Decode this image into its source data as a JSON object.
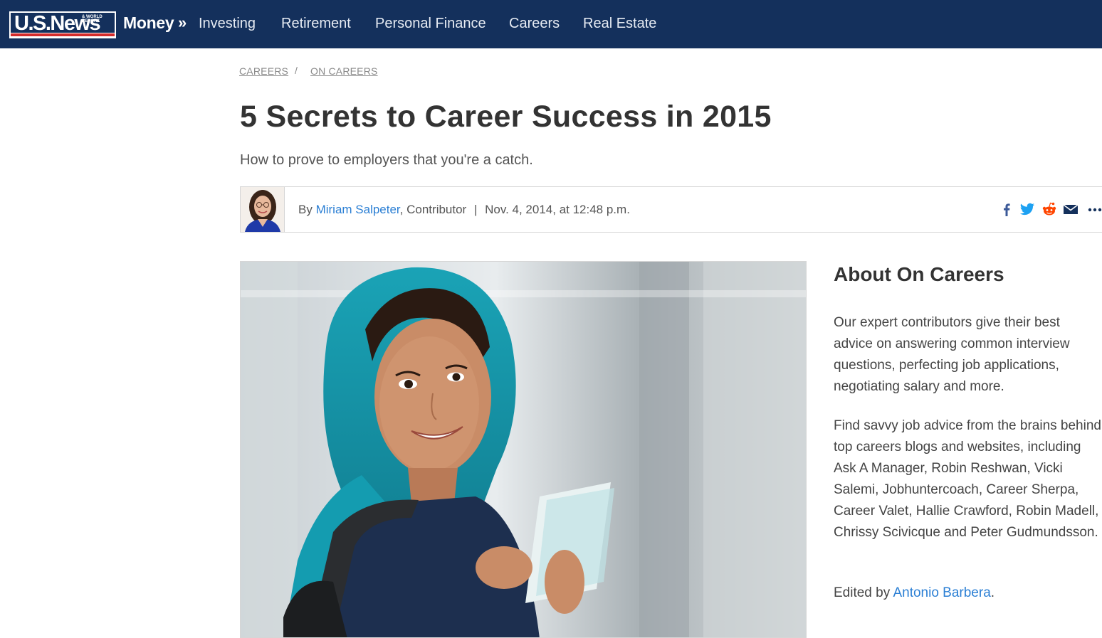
{
  "header": {
    "logo_text": "U.S.News",
    "logo_small": "& WORLD REPORT",
    "section": "Money",
    "section_chevron": "»",
    "nav": [
      "Investing",
      "Retirement",
      "Personal Finance",
      "Careers",
      "Real Estate"
    ]
  },
  "breadcrumb": {
    "items": [
      "CAREERS",
      "ON CAREERS"
    ],
    "separator": "/"
  },
  "article": {
    "title": "5 Secrets to Career Success in 2015",
    "subtitle": "How to prove to employers that you're a catch.",
    "byline_prefix": "By ",
    "author": "Miriam Salpeter",
    "author_role": ", Contributor",
    "date_separator": "|",
    "date": "Nov. 4, 2014, at 12:48 p.m."
  },
  "share": {
    "icons": [
      "facebook-icon",
      "twitter-icon",
      "reddit-icon",
      "email-icon",
      "more-icon"
    ],
    "colors": {
      "facebook": "#3b5998",
      "twitter": "#1da1f2",
      "reddit": "#ff4500",
      "email": "#14305c"
    }
  },
  "sidebar": {
    "title": "About On Careers",
    "paragraph1": "Our expert contributors give their best advice on answering common interview questions, perfecting job applications, negotiating salary and more.",
    "paragraph2": "Find savvy job advice from the brains behind top careers blogs and websites, including Ask A Manager, Robin Reshwan, Vicki Salemi, Jobhuntercoach, Career Sherpa, Career Valet, Hallie Crawford, Robin Madell, Chrissy Scivicque and Peter Gudmundsson.",
    "edited_prefix": "Edited by ",
    "editor": "Antonio Barbera",
    "edited_suffix": "."
  },
  "colors": {
    "nav_bg": "#14305c",
    "link": "#2b7fd4",
    "logo_stripe": "#d42b2b"
  }
}
